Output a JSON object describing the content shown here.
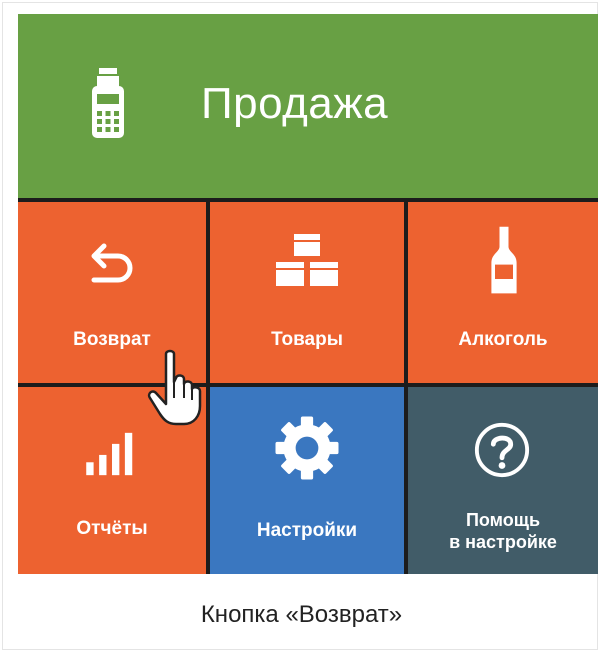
{
  "header": {
    "title": "Продажа",
    "icon": "cash-register-icon"
  },
  "tiles": {
    "return": {
      "label": "Возврат",
      "icon": "return-arrow-icon"
    },
    "goods": {
      "label": "Товары",
      "icon": "boxes-icon"
    },
    "alcohol": {
      "label": "Алкоголь",
      "icon": "bottle-icon"
    },
    "reports": {
      "label": "Отчёты",
      "icon": "bar-chart-icon"
    },
    "settings": {
      "label": "Настройки",
      "icon": "gear-icon"
    },
    "help": {
      "label_line1": "Помощь",
      "label_line2": "в настройке",
      "icon": "question-icon"
    }
  },
  "caption": "Кнопка «Возврат»",
  "colors": {
    "header": "#68a044",
    "orange": "#ed6230",
    "blue": "#3a77c0",
    "slate": "#415c68"
  }
}
